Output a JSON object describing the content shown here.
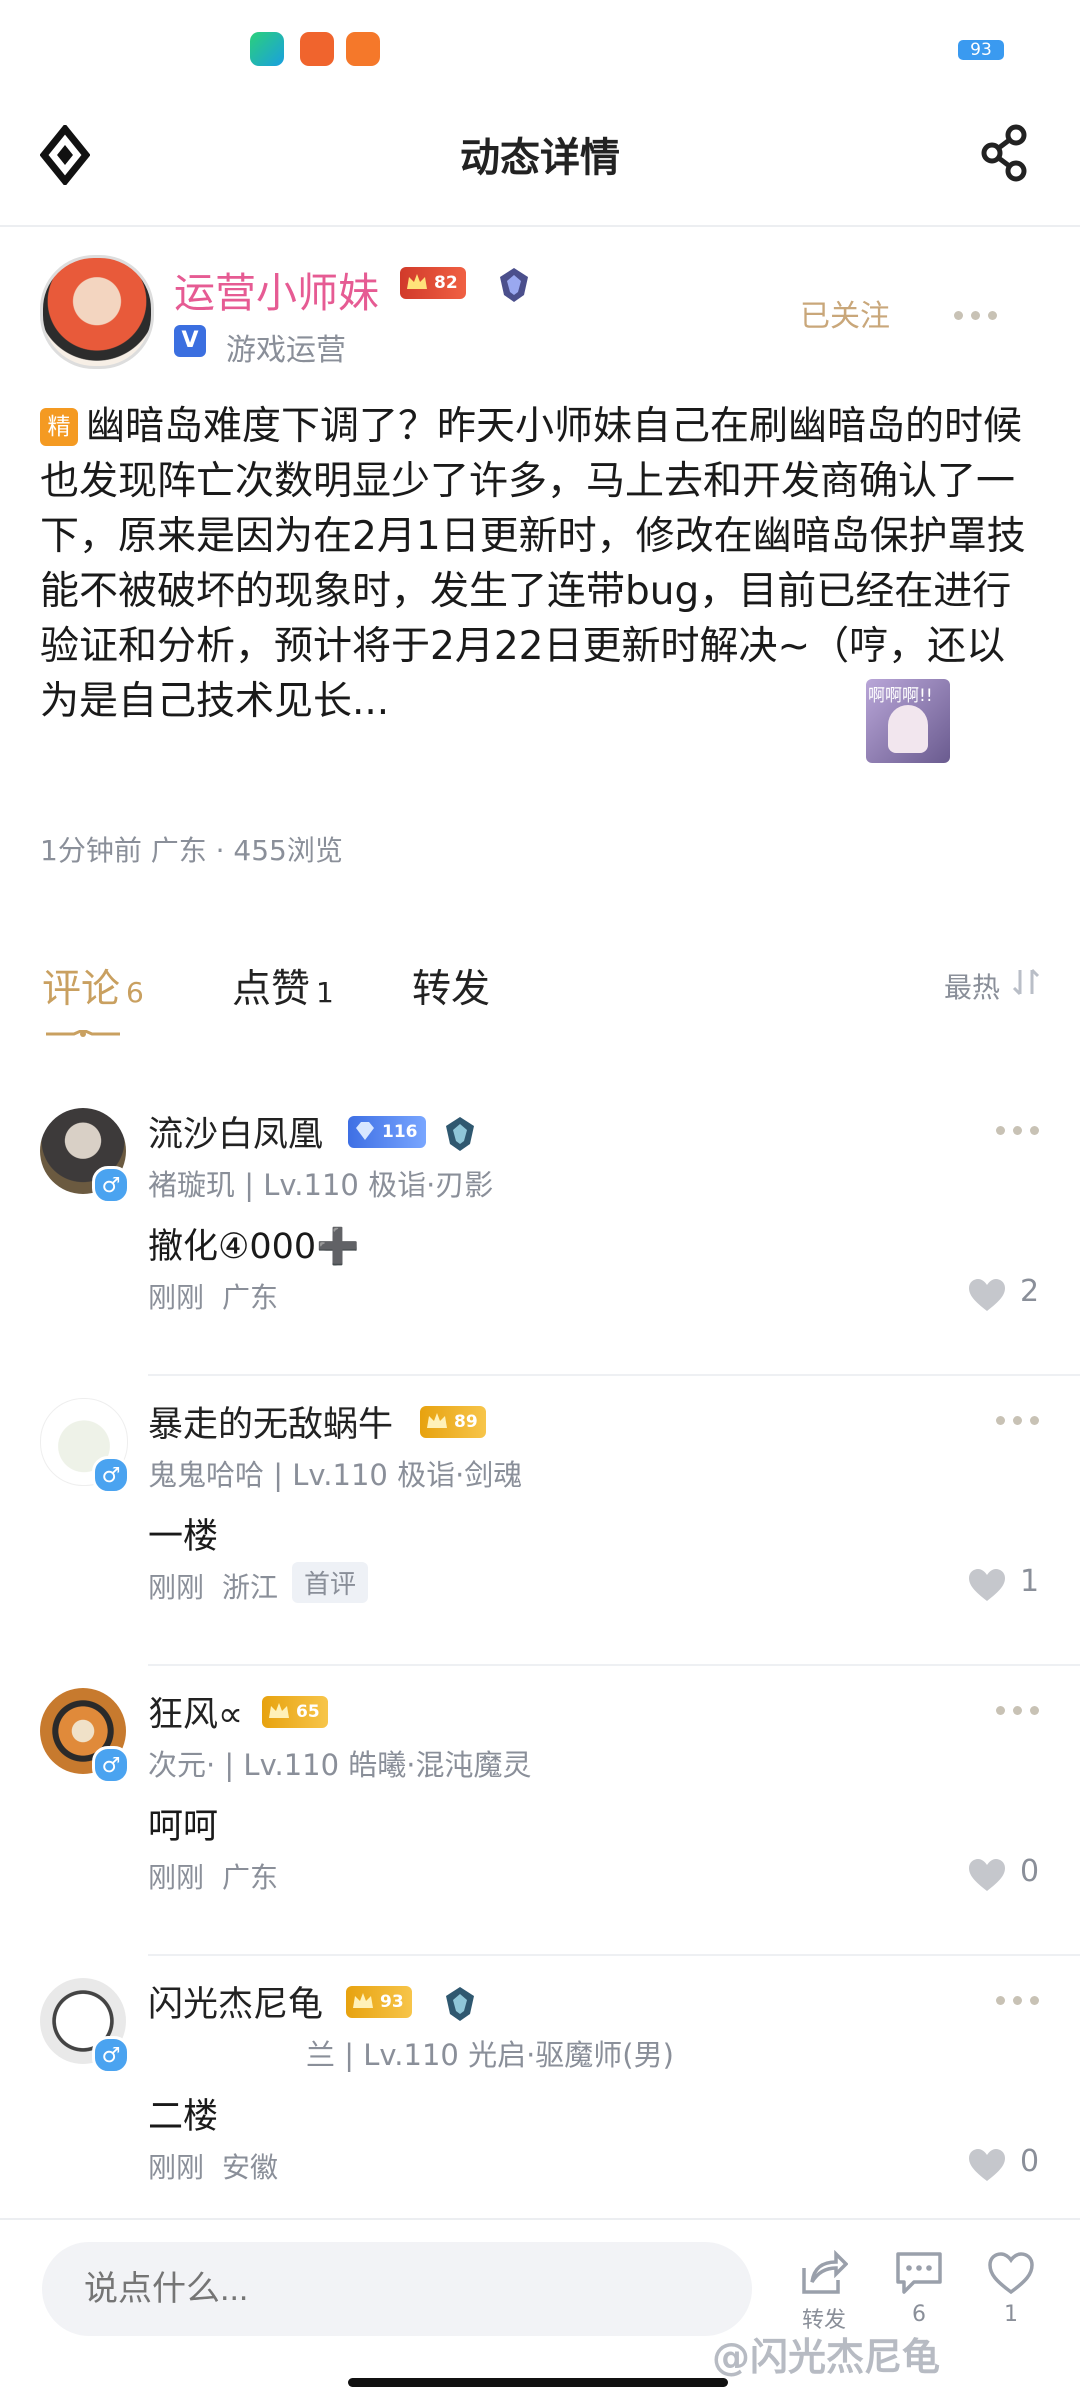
{
  "header": {
    "title": "动态详情"
  },
  "status_bar": {
    "battery": "93"
  },
  "post": {
    "author": {
      "name": "运营小师妹",
      "level": "82",
      "subtitle": "游戏运营",
      "verified_mark": "V"
    },
    "follow_label": "已关注",
    "essence_tag": "精",
    "content": "幽暗岛难度下调了？昨天小师妹自己在刷幽暗岛的时候也发现阵亡次数明显少了许多，马上去和开发商确认了一下，原来是因为在2月1日更新时，修改在幽暗岛保护罩技能不被破坏的现象时，发生了连带bug，目前已经在进行验证和分析，预计将于2月22日更新时解决~（哼，还以为是自己技术见长...",
    "sticker_text": "啊啊啊!!",
    "meta": "1分钟前  广东 · 455浏览"
  },
  "tabs": [
    {
      "label": "评论",
      "count": "6"
    },
    {
      "label": "点赞",
      "count": "1"
    },
    {
      "label": "转发",
      "count": ""
    }
  ],
  "sort_label": "最热",
  "comments": [
    {
      "name": "流沙白凤凰",
      "level": "116",
      "sub": "褚璇玑 | Lv.110 极诣·刃影",
      "text": "撤化④000➕",
      "time": "刚刚",
      "location": "广东",
      "likes": "2"
    },
    {
      "name": "暴走的无敌蜗牛",
      "level": "89",
      "sub": "鬼鬼哈哈 | Lv.110 极诣·剑魂",
      "text": "一楼",
      "time": "刚刚",
      "location": "浙江",
      "tag": "首评",
      "likes": "1"
    },
    {
      "name": "狂风∝",
      "level": "65",
      "sub": "次元· | Lv.110 皓曦·混沌魔灵",
      "text": "呵呵",
      "time": "刚刚",
      "location": "广东",
      "likes": "0"
    },
    {
      "name": "闪光杰尼龟",
      "level": "93",
      "sub": "兰 | Lv.110 光启·驱魔师(男)",
      "text": "二楼",
      "time": "刚刚",
      "location": "安徽",
      "likes": "0"
    }
  ],
  "gender_symbol": "♂",
  "bottom": {
    "input_placeholder": "说点什么...",
    "share_label": "转发",
    "comment_count": "6",
    "like_count": "1"
  },
  "watermark": "@闪光杰尼龟"
}
